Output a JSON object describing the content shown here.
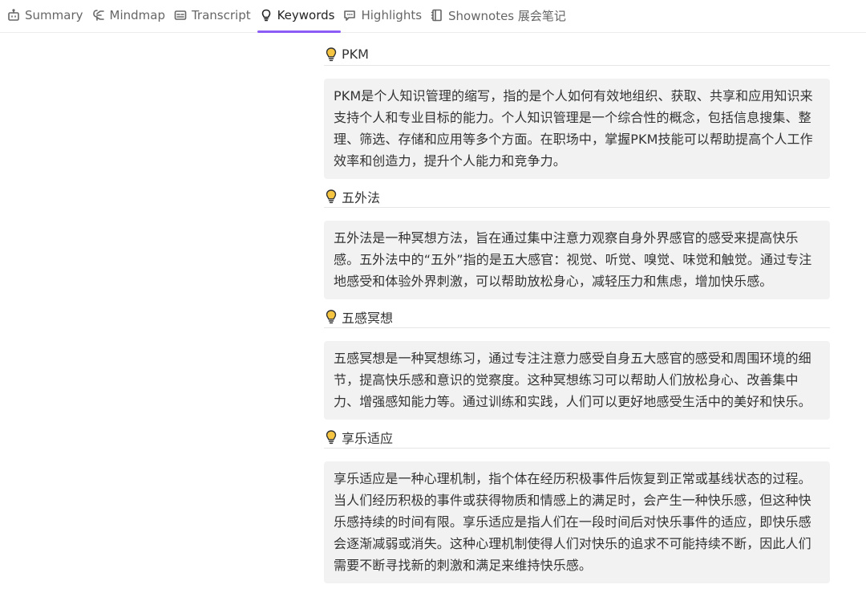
{
  "tabs": [
    {
      "label": "Summary",
      "icon": "robot-icon"
    },
    {
      "label": "Mindmap",
      "icon": "mindmap-icon"
    },
    {
      "label": "Transcript",
      "icon": "subtitles-icon"
    },
    {
      "label": "Keywords",
      "icon": "lightbulb-icon",
      "active": true
    },
    {
      "label": "Highlights",
      "icon": "chat-bubble-icon"
    },
    {
      "label": "Shownotes 展会笔记",
      "icon": "notebook-icon"
    }
  ],
  "colors": {
    "accent": "#8b5cf6",
    "bulb_fill": "#f5c542",
    "card_bg": "#f2f2f2"
  },
  "keywords": [
    {
      "title": "PKM",
      "text": "PKM是个人知识管理的缩写，指的是个人如何有效地组织、获取、共享和应用知识来支持个人和专业目标的能力。个人知识管理是一个综合性的概念，包括信息搜集、整理、筛选、存储和应用等多个方面。在职场中，掌握PKM技能可以帮助提高个人工作效率和创造力，提升个人能力和竞争力。"
    },
    {
      "title": "五外法",
      "text": "五外法是一种冥想方法，旨在通过集中注意力观察自身外界感官的感受来提高快乐感。五外法中的“五外”指的是五大感官：视觉、听觉、嗅觉、味觉和触觉。通过专注地感受和体验外界刺激，可以帮助放松身心，减轻压力和焦虑，增加快乐感。"
    },
    {
      "title": "五感冥想",
      "text": "五感冥想是一种冥想练习，通过专注注意力感受自身五大感官的感受和周围环境的细节，提高快乐感和意识的觉察度。这种冥想练习可以帮助人们放松身心、改善集中力、增强感知能力等。通过训练和实践，人们可以更好地感受生活中的美好和快乐。"
    },
    {
      "title": "享乐适应",
      "text": "享乐适应是一种心理机制，指个体在经历积极事件后恢复到正常或基线状态的过程。当人们经历积极的事件或获得物质和情感上的满足时，会产生一种快乐感，但这种快乐感持续的时间有限。享乐适应是指人们在一段时间后对快乐事件的适应，即快乐感会逐渐减弱或消失。这种心理机制使得人们对快乐的追求不可能持续不断，因此人们需要不断寻找新的刺激和满足来维持快乐感。"
    }
  ]
}
